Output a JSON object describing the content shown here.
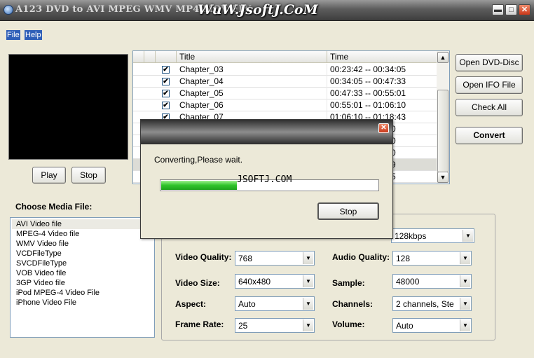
{
  "window": {
    "title": "A123 DVD to AVI MPEG WMV MP4 MOV FLV",
    "watermark": "WuW.JsoftJ.CoM"
  },
  "menu": {
    "file": "File",
    "help": "Help"
  },
  "player": {
    "play_label": "Play",
    "stop_label": "Stop"
  },
  "chapters": {
    "headers": {
      "title": "Title",
      "time": "Time"
    },
    "rows": [
      {
        "title": "Chapter_03",
        "time": "00:23:42 -- 00:34:05",
        "checked": true
      },
      {
        "title": "Chapter_04",
        "time": "00:34:05 -- 00:47:33",
        "checked": true
      },
      {
        "title": "Chapter_05",
        "time": "00:47:33 -- 00:55:01",
        "checked": true
      },
      {
        "title": "Chapter_06",
        "time": "00:55:01 -- 01:06:10",
        "checked": true
      },
      {
        "title": "Chapter_07",
        "time": "01:06:10 -- 01:18:43",
        "checked": true
      }
    ],
    "hidden_row_fragments": [
      "0",
      "0",
      "0",
      "9",
      "5"
    ]
  },
  "side_buttons": {
    "open_dvd": "Open DVD-Disc",
    "open_ifo": "Open IFO File",
    "check_all": "Check All",
    "convert": "Convert"
  },
  "media": {
    "label": "Choose Media File:",
    "items": [
      "AVI Video file",
      "MPEG-4 Video file",
      "WMV Video file",
      "VCDFileType",
      "SVCDFileType",
      "VOB Video file",
      "3GP Video file",
      "iPod MPEG-4 Video File",
      "iPhone Video File"
    ],
    "selected_index": 0
  },
  "settings": {
    "audio_bitrate": "128kbps",
    "video_quality": {
      "label": "Video Quality:",
      "value": "768"
    },
    "audio_quality": {
      "label": "Audio Quality:",
      "value": "128"
    },
    "video_size": {
      "label": "Video Size:",
      "value": "640x480"
    },
    "sample": {
      "label": "Sample:",
      "value": "48000"
    },
    "aspect": {
      "label": "Aspect:",
      "value": "Auto"
    },
    "channels": {
      "label": "Channels:",
      "value": "2 channels, Ste"
    },
    "frame_rate": {
      "label": "Frame Rate:",
      "value": "25"
    },
    "volume": {
      "label": "Volume:",
      "value": "Auto"
    }
  },
  "dialog": {
    "message": "Converting,Please wait.",
    "brand": "JSOFTJ.COM",
    "progress_percent": 35,
    "stop_label": "Stop",
    "close_glyph": "✕"
  },
  "icons": {
    "check": "✔",
    "minimize": "▬",
    "maximize": "□",
    "close": "✕",
    "scroll_up": "▲",
    "scroll_down": "▼",
    "dropdown": "▼"
  }
}
